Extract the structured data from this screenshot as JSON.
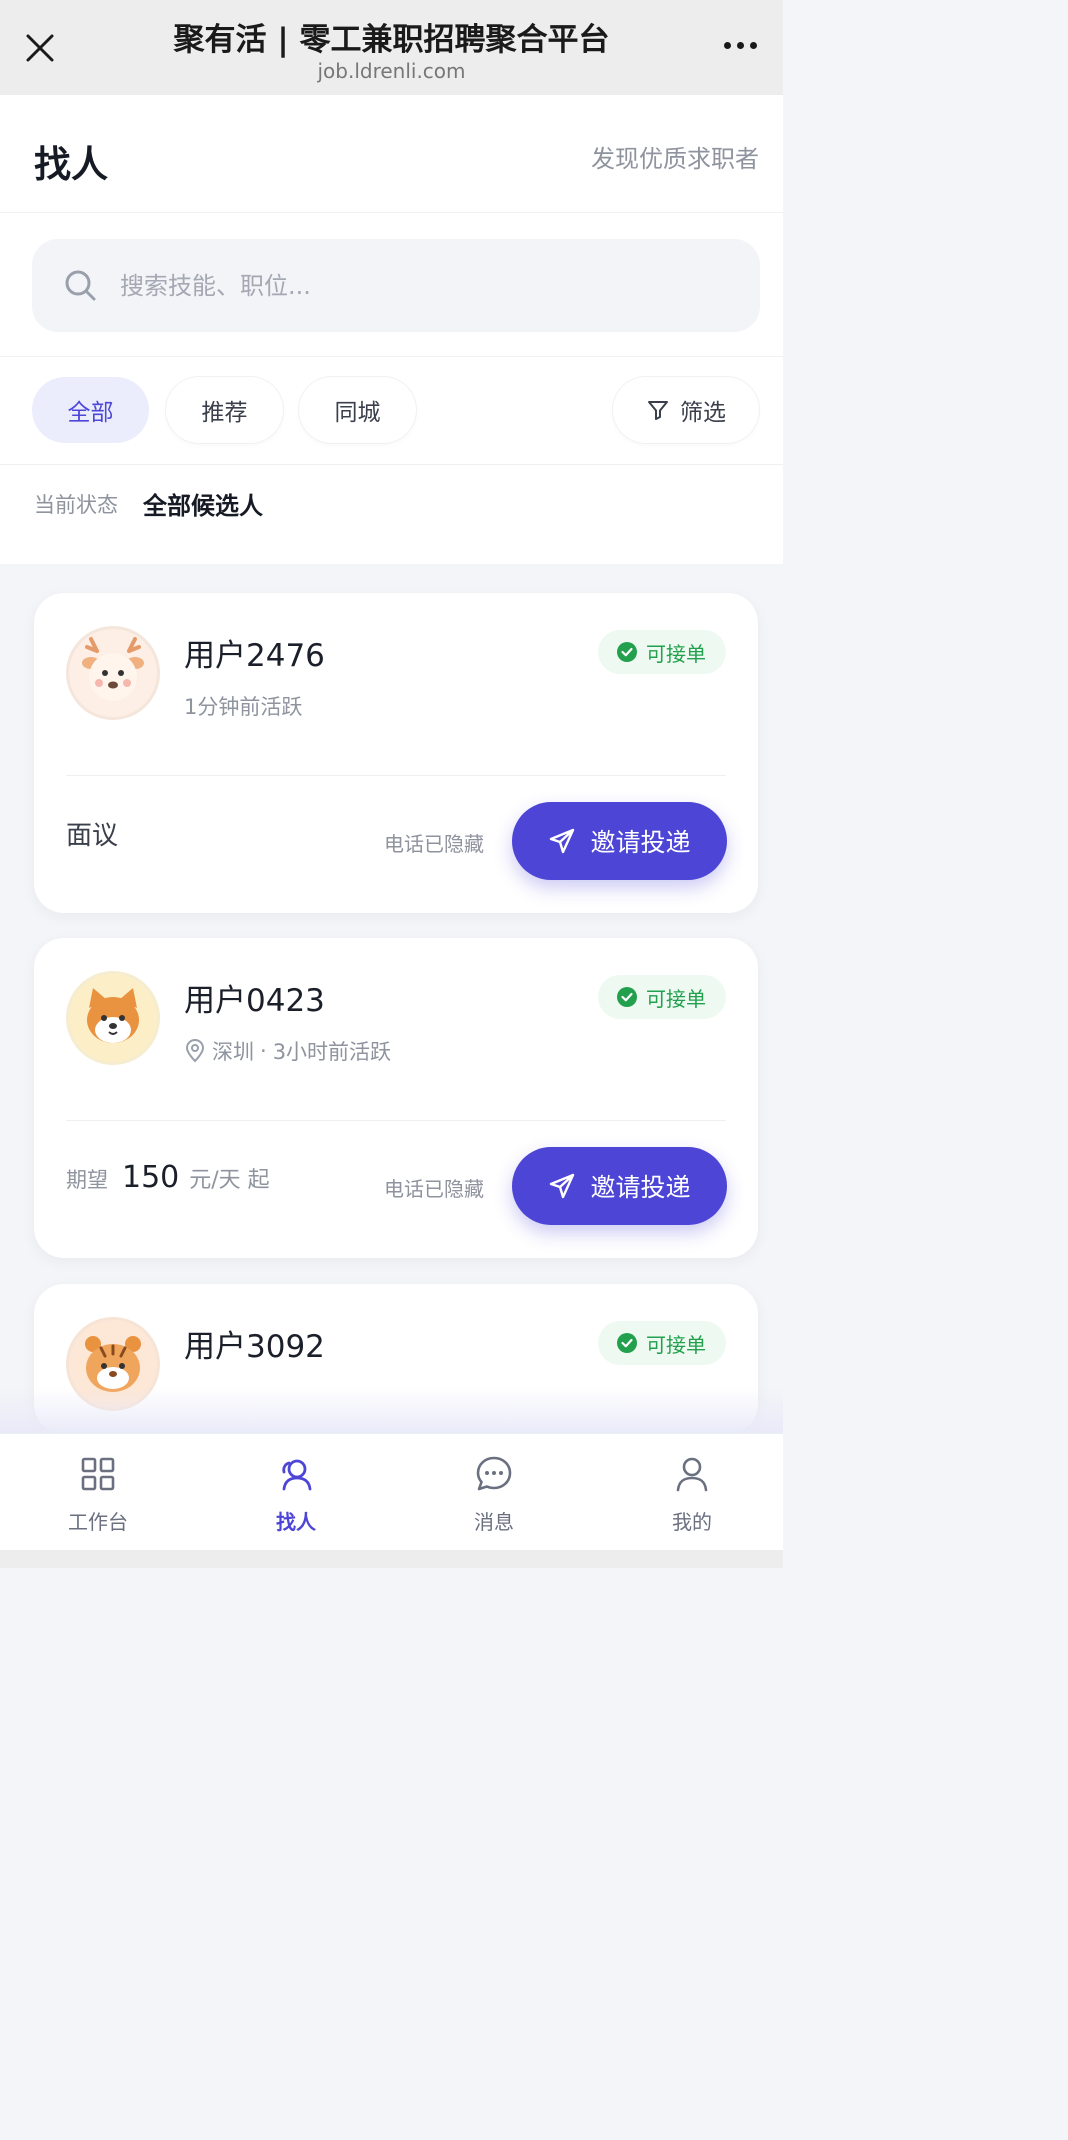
{
  "browser": {
    "title": "聚有活 | 零工兼职招聘聚合平台",
    "url": "job.ldrenli.com"
  },
  "header": {
    "title": "找人",
    "subtitle": "发现优质求职者"
  },
  "search": {
    "placeholder": "搜索技能、职位..."
  },
  "filters": {
    "chips": [
      "全部",
      "推荐",
      "同城"
    ],
    "active": "全部",
    "filter_label": "筛选"
  },
  "status": {
    "label": "当前状态",
    "value": "全部候选人"
  },
  "candidates": [
    {
      "name": "用户2476",
      "meta": "1分钟前活跃",
      "location": "",
      "badge": "可接单",
      "salary_text": "面议",
      "phone": "电话已隐藏",
      "invite": "邀请投递",
      "avatar": "deer-avatar"
    },
    {
      "name": "用户0423",
      "location": "深圳",
      "meta": "3小时前活跃",
      "badge": "可接单",
      "salary_label": "期望",
      "salary_amount": "150",
      "salary_unit": "元/天 起",
      "phone": "电话已隐藏",
      "invite": "邀请投递",
      "avatar": "shiba-avatar"
    },
    {
      "name": "用户3092",
      "badge": "可接单",
      "avatar": "tiger-avatar"
    }
  ],
  "tabbar": {
    "items": [
      "工作台",
      "找人",
      "消息",
      "我的"
    ],
    "active": "找人"
  },
  "colors": {
    "primary": "#4d45d6",
    "success": "#22a04d",
    "chip_active_bg": "#ebedfd"
  }
}
